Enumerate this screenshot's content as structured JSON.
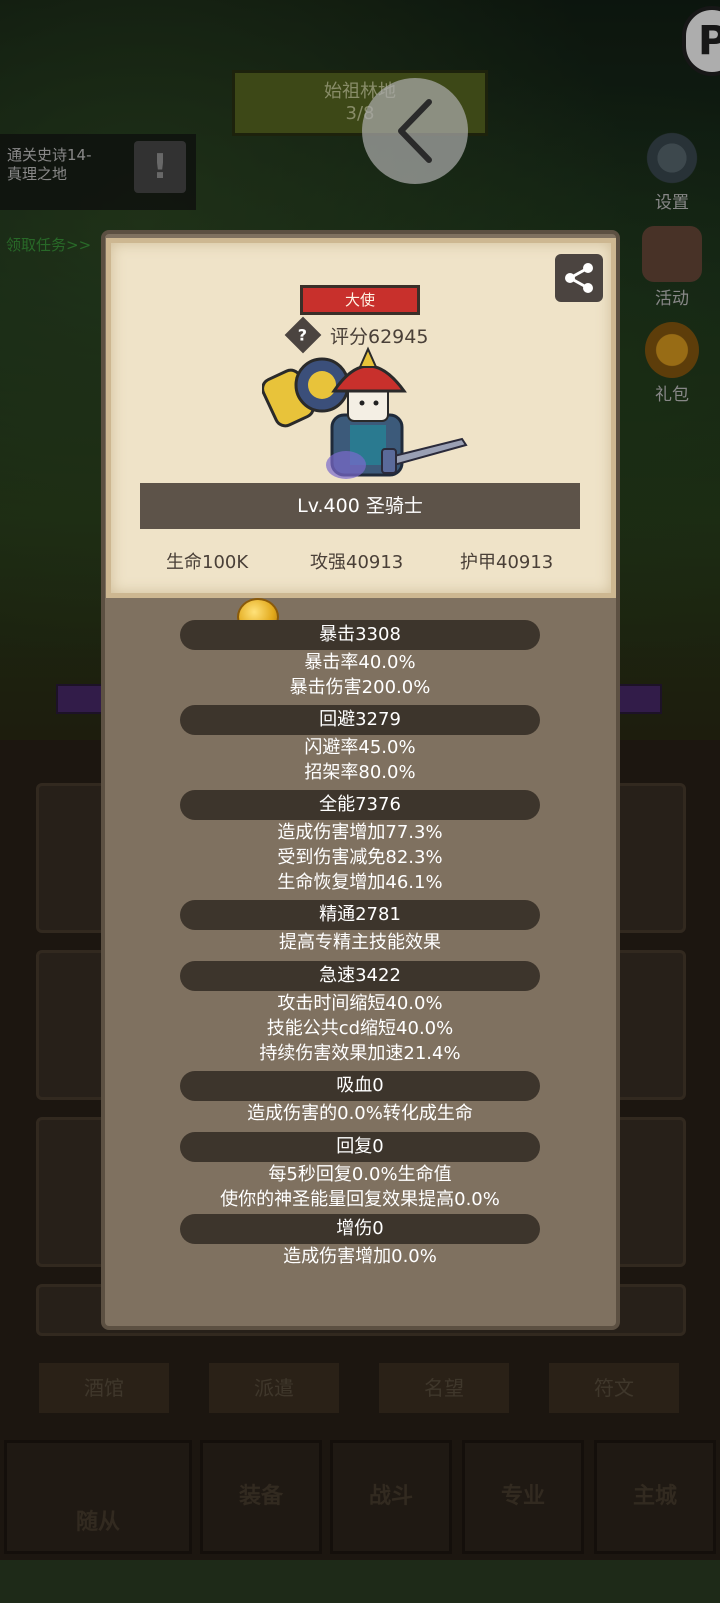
{
  "background": {
    "zone": {
      "name": "始祖林地",
      "progress": "3/8"
    },
    "quest": {
      "text_line1": "通关史诗14-",
      "text_line2": "真理之地",
      "alert": "!",
      "link": "领取任务>>"
    },
    "side_menu": [
      {
        "label": "设置",
        "icon": "gear-icon"
      },
      {
        "label": "活动",
        "icon": "scroll-icon"
      },
      {
        "label": "礼包",
        "icon": "gift-coin-icon"
      }
    ],
    "sub_tabs": [
      "酒馆",
      "派遣",
      "名望",
      "符文"
    ],
    "main_tabs": [
      "随从",
      "装备",
      "战斗",
      "专业",
      "主城"
    ]
  },
  "hero": {
    "title": "大使",
    "score": "评分62945",
    "level_class": "Lv.400 圣骑士",
    "base_stats": {
      "hp": "生命100K",
      "attack": "攻强40913",
      "armor": "护甲40913"
    }
  },
  "stats": [
    {
      "header": "暴击3308",
      "lines": [
        "暴击率40.0%",
        "暴击伤害200.0%"
      ]
    },
    {
      "header": "回避3279",
      "lines": [
        "闪避率45.0%",
        "招架率80.0%"
      ]
    },
    {
      "header": "全能7376",
      "lines": [
        "造成伤害增加77.3%",
        "受到伤害减免82.3%",
        "生命恢复增加46.1%"
      ]
    },
    {
      "header": "精通2781",
      "lines": [
        "提高专精主技能效果"
      ]
    },
    {
      "header": "急速3422",
      "lines": [
        "攻击时间缩短40.0%",
        "技能公共cd缩短40.0%",
        "持续伤害效果加速21.4%"
      ]
    },
    {
      "header": "吸血0",
      "lines": [
        "造成伤害的0.0%转化成生命"
      ]
    },
    {
      "header": "回复0",
      "lines": [
        "每5秒回复0.0%生命值",
        "使你的神圣能量回复效果提高0.0%"
      ]
    },
    {
      "header": "增伤0",
      "lines": [
        "造成伤害增加0.0%"
      ]
    }
  ],
  "colors": {
    "title_badge": "#c8302c",
    "card": "#efe3c8",
    "modal": "#7f7160",
    "stat_header": "#3d352c"
  }
}
